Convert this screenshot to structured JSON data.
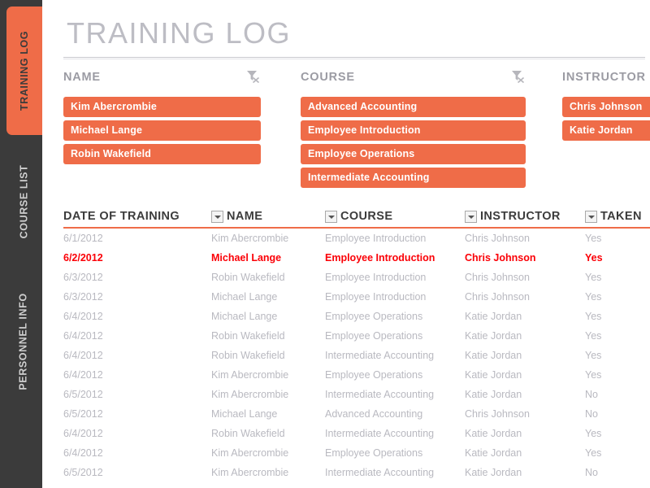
{
  "colors": {
    "accent": "#ef6c48",
    "sidebar_bg": "#3b3b3b",
    "title_gray": "#bdbdc4",
    "body_gray": "#b9b9c0",
    "highlight_red": "#fb0007"
  },
  "sidebar": {
    "tabs": [
      {
        "label": "TRAINING LOG",
        "active": true
      },
      {
        "label": "COURSE LIST",
        "active": false
      },
      {
        "label": "PERSONNEL INFO",
        "active": false
      }
    ]
  },
  "header": {
    "title": "TRAINING LOG"
  },
  "filters": [
    {
      "title": "NAME",
      "clear_icon": "clear-filter-icon",
      "chips": [
        "Kim Abercrombie",
        "Michael Lange",
        "Robin Wakefield"
      ]
    },
    {
      "title": "COURSE",
      "clear_icon": "clear-filter-icon",
      "chips": [
        "Advanced Accounting",
        "Employee Introduction",
        "Employee Operations",
        "Intermediate Accounting"
      ]
    },
    {
      "title": "INSTRUCTOR",
      "clear_icon": null,
      "chips": [
        "Chris Johnson",
        "Katie Jordan"
      ]
    }
  ],
  "table": {
    "columns": [
      {
        "label": "DATE OF TRAINING",
        "has_dropdown": false
      },
      {
        "label": "NAME",
        "has_dropdown": true
      },
      {
        "label": "COURSE",
        "has_dropdown": true
      },
      {
        "label": "INSTRUCTOR",
        "has_dropdown": true
      },
      {
        "label": "TAKEN",
        "has_dropdown": true
      }
    ],
    "rows": [
      {
        "date": "6/1/2012",
        "name": "Kim Abercrombie",
        "course": "Employee Introduction",
        "instructor": "Chris Johnson",
        "taken": "Yes",
        "highlight": false
      },
      {
        "date": "6/2/2012",
        "name": "Michael Lange",
        "course": "Employee Introduction",
        "instructor": "Chris Johnson",
        "taken": "Yes",
        "highlight": true
      },
      {
        "date": "6/3/2012",
        "name": "Robin Wakefield",
        "course": "Employee Introduction",
        "instructor": "Chris Johnson",
        "taken": "Yes",
        "highlight": false
      },
      {
        "date": "6/3/2012",
        "name": "Michael Lange",
        "course": "Employee Introduction",
        "instructor": "Chris Johnson",
        "taken": "Yes",
        "highlight": false
      },
      {
        "date": "6/4/2012",
        "name": "Michael Lange",
        "course": "Employee Operations",
        "instructor": "Katie Jordan",
        "taken": "Yes",
        "highlight": false
      },
      {
        "date": "6/4/2012",
        "name": "Robin Wakefield",
        "course": "Employee Operations",
        "instructor": "Katie Jordan",
        "taken": "Yes",
        "highlight": false
      },
      {
        "date": "6/4/2012",
        "name": "Robin Wakefield",
        "course": "Intermediate Accounting",
        "instructor": "Katie Jordan",
        "taken": "Yes",
        "highlight": false
      },
      {
        "date": "6/4/2012",
        "name": "Kim Abercrombie",
        "course": "Employee Operations",
        "instructor": "Katie Jordan",
        "taken": "Yes",
        "highlight": false
      },
      {
        "date": "6/5/2012",
        "name": "Kim Abercrombie",
        "course": "Intermediate Accounting",
        "instructor": "Katie Jordan",
        "taken": "No",
        "highlight": false
      },
      {
        "date": "6/5/2012",
        "name": "Michael Lange",
        "course": "Advanced Accounting",
        "instructor": "Chris Johnson",
        "taken": "No",
        "highlight": false
      },
      {
        "date": "6/4/2012",
        "name": "Robin Wakefield",
        "course": "Intermediate Accounting",
        "instructor": "Katie Jordan",
        "taken": "Yes",
        "highlight": false
      },
      {
        "date": "6/4/2012",
        "name": "Kim Abercrombie",
        "course": "Employee Operations",
        "instructor": "Katie Jordan",
        "taken": "Yes",
        "highlight": false
      },
      {
        "date": "6/5/2012",
        "name": "Kim Abercrombie",
        "course": "Intermediate Accounting",
        "instructor": "Katie Jordan",
        "taken": "No",
        "highlight": false
      }
    ]
  }
}
